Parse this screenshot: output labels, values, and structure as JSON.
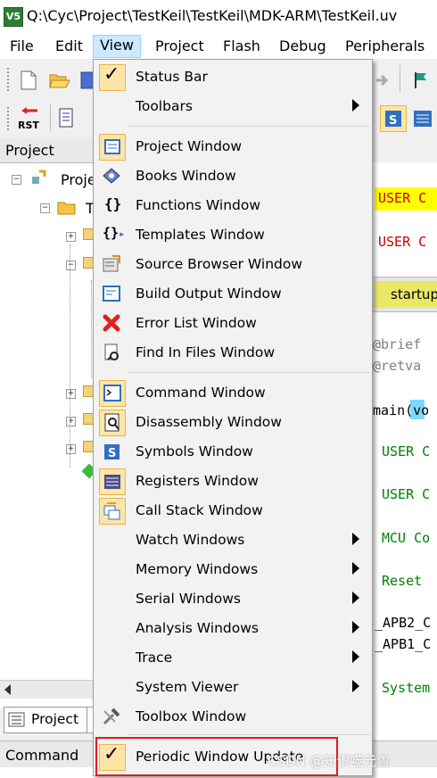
{
  "window": {
    "title": "Q:\\Cyc\\Project\\TestKeil\\TestKeil\\MDK-ARM\\TestKeil.uv",
    "app_icon_letter": "V5"
  },
  "menubar": {
    "items": [
      "File",
      "Edit",
      "View",
      "Project",
      "Flash",
      "Debug",
      "Peripherals"
    ]
  },
  "project_pane": {
    "title": "Project",
    "tree_items": [
      "Proje",
      "T"
    ],
    "tab_label": "Project"
  },
  "command_pane": {
    "title": "Command"
  },
  "editor": {
    "tab_label": "startup",
    "lines": [
      "USER C",
      "USER C",
      "@brief",
      "@retva",
      "main(vo",
      "USER C",
      "USER C",
      "MCU Co",
      "Reset",
      "_APB2_C",
      "_APB1_C",
      "System"
    ]
  },
  "view_menu": {
    "items": [
      {
        "label": "Status Bar",
        "checked": true,
        "icon": "check-icon",
        "submenu": false
      },
      {
        "label": "Toolbars",
        "checked": false,
        "icon": "",
        "submenu": true
      },
      {
        "label": "Project Window",
        "checked": false,
        "icon": "project-window-icon",
        "submenu": false
      },
      {
        "label": "Books Window",
        "checked": false,
        "icon": "books-window-icon",
        "submenu": false
      },
      {
        "label": "Functions Window",
        "checked": false,
        "icon": "functions-braces-icon",
        "submenu": false
      },
      {
        "label": "Templates Window",
        "checked": false,
        "icon": "templates-icon",
        "submenu": false
      },
      {
        "label": "Source Browser Window",
        "checked": false,
        "icon": "source-browser-icon",
        "submenu": false
      },
      {
        "label": "Build Output Window",
        "checked": false,
        "icon": "build-output-icon",
        "submenu": false
      },
      {
        "label": "Error List Window",
        "checked": false,
        "icon": "error-x-icon",
        "submenu": false
      },
      {
        "label": "Find In Files Window",
        "checked": false,
        "icon": "find-in-files-icon",
        "submenu": false
      },
      {
        "label": "Command Window",
        "checked": false,
        "icon": "command-window-icon",
        "submenu": false
      },
      {
        "label": "Disassembly Window",
        "checked": false,
        "icon": "disassembly-icon",
        "submenu": false
      },
      {
        "label": "Symbols Window",
        "checked": false,
        "icon": "symbols-icon",
        "submenu": false
      },
      {
        "label": "Registers Window",
        "checked": false,
        "icon": "registers-icon",
        "submenu": false
      },
      {
        "label": "Call Stack Window",
        "checked": false,
        "icon": "call-stack-icon",
        "submenu": false
      },
      {
        "label": "Watch Windows",
        "checked": false,
        "icon": "",
        "submenu": true
      },
      {
        "label": "Memory Windows",
        "checked": false,
        "icon": "",
        "submenu": true
      },
      {
        "label": "Serial Windows",
        "checked": false,
        "icon": "",
        "submenu": true
      },
      {
        "label": "Analysis Windows",
        "checked": false,
        "icon": "",
        "submenu": true
      },
      {
        "label": "Trace",
        "checked": false,
        "icon": "",
        "submenu": true
      },
      {
        "label": "System Viewer",
        "checked": false,
        "icon": "",
        "submenu": true
      },
      {
        "label": "Toolbox Window",
        "checked": false,
        "icon": "toolbox-icon",
        "submenu": false
      },
      {
        "label": "Periodic Window Update",
        "checked": true,
        "icon": "check-icon",
        "submenu": false
      }
    ]
  },
  "watermark": "CSDN @知识噬元兽",
  "colors": {
    "menu_bg": "#f2f2f2",
    "check_bg": "#fde5a8",
    "highlight": "#e21a1a",
    "editor_yellow": "#ffff00"
  }
}
